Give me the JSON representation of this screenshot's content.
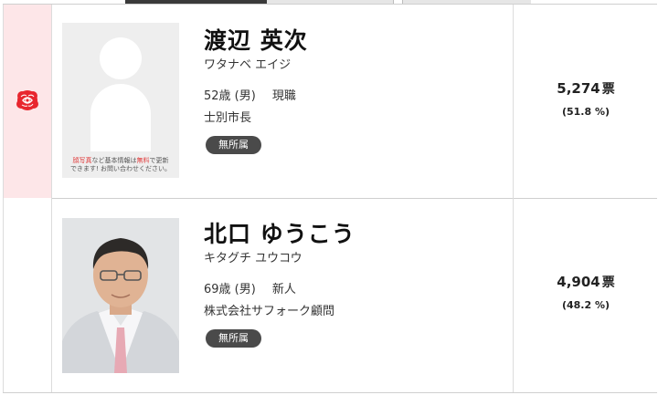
{
  "candidates": [
    {
      "name": "渡辺 英次",
      "kana": "ワタナベ エイジ",
      "age": "52歳 (男)",
      "status": "現職",
      "job": "士別市長",
      "party": "無所属",
      "votes": "5,274",
      "vote_unit": "票",
      "percent": "(51.8 %)",
      "elected": true,
      "photo_note_red": "顔写真",
      "photo_note_mid": "など基本情報は",
      "photo_note_red2": "無料",
      "photo_note_end": "で更新",
      "photo_note_line2": "できます! お問い合わせください。"
    },
    {
      "name": "北口 ゆうこう",
      "kana": "キタグチ ユウコウ",
      "age": "69歳 (男)",
      "status": "新人",
      "job": "株式会社サフォーク顧問",
      "party": "無所属",
      "votes": "4,904",
      "vote_unit": "票",
      "percent": "(48.2 %)",
      "elected": false
    }
  ],
  "colors": {
    "elected_bg": "#fde6e8",
    "rose": "#e8262e",
    "party_badge": "#4a4a4a"
  },
  "icons": {
    "elected_mark": "rose-icon",
    "photo_placeholder": "person-silhouette-icon"
  }
}
